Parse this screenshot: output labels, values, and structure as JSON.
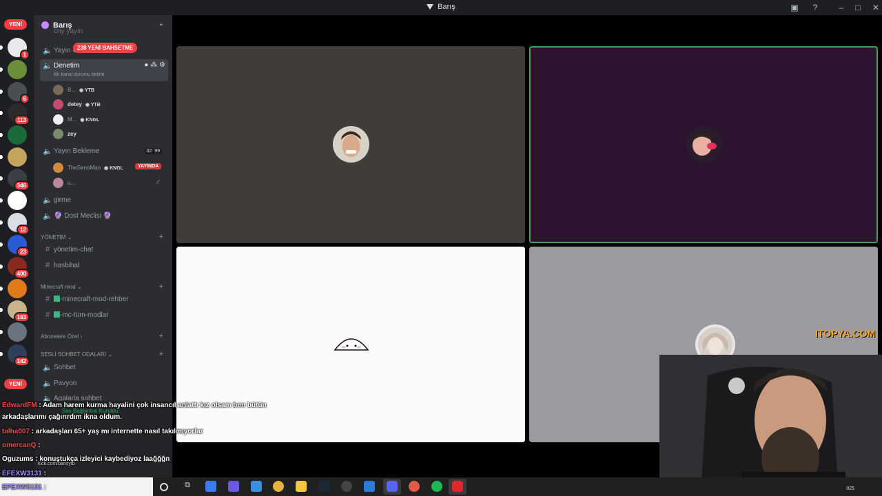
{
  "window": {
    "title": "Barış"
  },
  "rail": {
    "new_top": "YENİ",
    "new_bottom": "YENİ",
    "servers": [
      {
        "name": "server-1",
        "badge": "1",
        "color": "#e9e9e9"
      },
      {
        "name": "server-2",
        "badge": "",
        "color": "#6b8e3a"
      },
      {
        "name": "server-3",
        "badge": "6",
        "color": "#4a4d52"
      },
      {
        "name": "server-4",
        "badge": "113",
        "color": "#2b2b2b"
      },
      {
        "name": "server-5",
        "badge": "",
        "color": "#1a6b3c"
      },
      {
        "name": "server-6",
        "badge": "",
        "color": "#c4a35a"
      },
      {
        "name": "server-7",
        "badge": "346",
        "color": "#3b3f45"
      },
      {
        "name": "server-8",
        "badge": "",
        "color": "#ffffff"
      },
      {
        "name": "server-9",
        "badge": "12",
        "color": "#d9dde6"
      },
      {
        "name": "server-10",
        "badge": "23",
        "color": "#2a5bd7"
      },
      {
        "name": "server-11",
        "badge": "400",
        "color": "#8a2a1f"
      },
      {
        "name": "server-12",
        "badge": "",
        "color": "#e07a1a"
      },
      {
        "name": "server-13",
        "badge": "163",
        "color": "#c9b48a"
      },
      {
        "name": "server-14",
        "badge": "",
        "color": "#6a7380"
      },
      {
        "name": "server-15",
        "badge": "142",
        "color": "#2e3f5c"
      }
    ]
  },
  "guild": {
    "name": "Barış",
    "mention_pill": "238 YENİ BAHSETME"
  },
  "channels": {
    "partial_top_1": "criy yayın",
    "partial_top_2": "Yayın Odası",
    "active": {
      "label": "Denetim",
      "status": "Bir kanal durumu belirle"
    },
    "denetim_users": [
      {
        "name": "B...",
        "tag": "YTB",
        "bold": false,
        "color": "#7a6a5a"
      },
      {
        "name": "detey",
        "tag": "YTB",
        "bold": true,
        "color": "#c74a6a"
      },
      {
        "name": "M...",
        "tag": "KNGL",
        "bold": false,
        "color": "#f0f0f0"
      },
      {
        "name": "zey",
        "tag": "",
        "bold": true,
        "color": "#7a8a6a"
      }
    ],
    "yayin_bekleme": {
      "label": "Yayın Bekleme",
      "count_a": "02",
      "count_b": "99"
    },
    "bekleme_users": [
      {
        "name": "TheSenoMan",
        "tag": "KNGL",
        "live": "YAYINDA",
        "color": "#d08a3a"
      },
      {
        "name": "u...",
        "tag": "",
        "live": "",
        "color": "#b88a9a"
      }
    ],
    "girme": "girme",
    "dost_meclisi": "🔮 Dost Meclisi 🔮",
    "cat_yonetim": "YÖNETİM",
    "yonetim_chat": "yönetim-chat",
    "hasbihal": "hasbihal",
    "cat_minecraft": "Minecraft mod",
    "mc_rehber": "-minecraft-mod-rehber",
    "mc_tum": "-mc-tüm-modlar",
    "cat_abonelere": "Abonelere Özel",
    "cat_sesli": "SESLİ SOHBET ODALARI",
    "sohbet": "Sohbet",
    "pavyon": "Pavyon",
    "agalarla": "Agalarla sohbet",
    "voice_status": "Ses Bağlantısı Kuruldu"
  },
  "chat": [
    {
      "user": "EdwardFM",
      "user_color": "#e05252",
      "text": ": Adam harem kurma hayalini çok insancıl anlattı kız olsam ben bütün"
    },
    {
      "user": "",
      "user_color": "#ffffff",
      "text": "arkadaşlarımı çağırırdım ikna oldum."
    },
    {
      "user": "talha007",
      "user_color": "#e05252",
      "text": ": arkadaşları 65+ yaş mı internette nasıl takılmıyorlar"
    },
    {
      "user": "omercanQ",
      "user_color": "#e05252",
      "text": ":"
    },
    {
      "user": "Oguzums",
      "user_color": "#ffffff",
      "text": ": konuştukça izleyici kaybediyoz  laağğğn"
    },
    {
      "user": "EFEXW3131",
      "user_color": "#a78bfa",
      "text": ":"
    },
    {
      "user": "EFEXW3131",
      "user_color": "#a78bfa",
      "text": ":"
    }
  ],
  "overlay": {
    "sponsor": "ITOPYA.COM",
    "kick": "kick.com/barisytb"
  },
  "taskbar": {
    "time": "025"
  },
  "colors": {
    "accent": "#f23f43",
    "live": "#da373c",
    "sidebar": "#2b2d31",
    "rail": "#1e1f22"
  }
}
